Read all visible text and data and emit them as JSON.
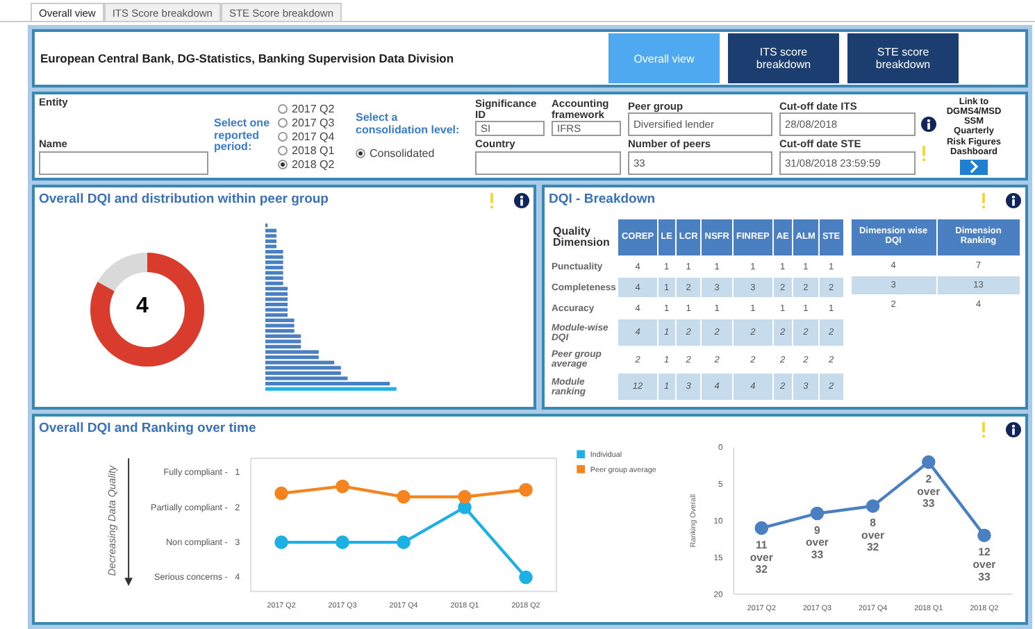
{
  "tabs": [
    {
      "label": "Overall view",
      "selected": true
    },
    {
      "label": "ITS Score breakdown",
      "selected": false
    },
    {
      "label": "STE Score breakdown",
      "selected": false
    }
  ],
  "header": {
    "title": "European Central Bank, DG-Statistics, Banking Supervision Data Division",
    "nav": [
      {
        "label": "Overall view",
        "selected": true
      },
      {
        "label": "ITS score breakdown",
        "selected": false
      },
      {
        "label": "STE score breakdown",
        "selected": false
      }
    ]
  },
  "filters": {
    "entity": {
      "label": "Entity"
    },
    "name": {
      "label": "Name"
    },
    "period": {
      "label": "Select one reported period:",
      "options": [
        {
          "label": "2017 Q2",
          "selected": false
        },
        {
          "label": "2017 Q3",
          "selected": false
        },
        {
          "label": "2017 Q4",
          "selected": false
        },
        {
          "label": "2018 Q1",
          "selected": false
        },
        {
          "label": "2018 Q2",
          "selected": true
        }
      ]
    },
    "consolidation": {
      "label": "Select a consolidation level:",
      "options": [
        {
          "label": "Consolidated",
          "selected": true
        }
      ]
    },
    "significance_id": {
      "label": "Significance ID",
      "value": "SI"
    },
    "accounting_framework": {
      "label": "Accounting framework",
      "value": "IFRS"
    },
    "country": {
      "label": "Country"
    },
    "peer_group": {
      "label": "Peer group",
      "value": "Diversified lender"
    },
    "number_of_peers": {
      "label": "Number of peers",
      "value": "33"
    },
    "cutoff_its": {
      "label": "Cut-off date ITS",
      "value": "28/08/2018"
    },
    "cutoff_ste": {
      "label": "Cut-off date STE",
      "value": "31/08/2018 23:59:59"
    },
    "link": {
      "label": "Link to DGMS4/MSD SSM Quarterly Risk Figures Dashboard"
    }
  },
  "overview": {
    "title": "Overall DQI and distribution within peer group",
    "score": "4",
    "level": 0.83
  },
  "breakdown": {
    "title": "DQI - Breakdown",
    "corner": "Quality Dimension",
    "modules": [
      "COREP",
      "LE",
      "LCR",
      "NSFR",
      "FINREP",
      "AE",
      "ALM",
      "STE"
    ],
    "rows": [
      {
        "label": "Punctuality",
        "kind": "dimension",
        "values": [
          "4",
          "1",
          "1",
          "1",
          "1",
          "1",
          "1",
          "1"
        ]
      },
      {
        "label": "Completeness",
        "kind": "dimension",
        "values": [
          "4",
          "1",
          "2",
          "3",
          "3",
          "2",
          "2",
          "2"
        ]
      },
      {
        "label": "Accuracy",
        "kind": "dimension",
        "values": [
          "4",
          "1",
          "1",
          "1",
          "1",
          "1",
          "1",
          "1"
        ]
      },
      {
        "label": "Module-wise DQI",
        "kind": "summary",
        "values": [
          "4",
          "1",
          "2",
          "2",
          "2",
          "2",
          "2",
          "2"
        ]
      },
      {
        "label": "Peer group average",
        "kind": "summary",
        "values": [
          "2",
          "1",
          "2",
          "2",
          "2",
          "2",
          "2",
          "2"
        ]
      },
      {
        "label": "Module ranking",
        "kind": "summary",
        "values": [
          "12",
          "1",
          "3",
          "4",
          "4",
          "2",
          "3",
          "2"
        ]
      }
    ],
    "side_columns": [
      "Dimension wise DQI",
      "Dimension Ranking"
    ],
    "side_rows": [
      [
        "4",
        "7"
      ],
      [
        "3",
        "13"
      ],
      [
        "2",
        "4"
      ]
    ]
  },
  "over_time": {
    "title": "Overall DQI and Ranking over time",
    "quality_chart": {
      "tick_descriptions": [
        "Fully compliant -",
        "Partially compliant -",
        "Non compliant -",
        "Serious concerns -"
      ],
      "chart_data": {
        "type": "line",
        "ylabel": "Decreasing Data Quality",
        "categories": [
          "2017 Q2",
          "2017 Q3",
          "2017 Q4",
          "2018 Q1",
          "2018 Q2"
        ],
        "ylim": [
          4.4,
          0.6
        ],
        "yticks": [
          1,
          2,
          3,
          4
        ],
        "legend": "right",
        "series": [
          {
            "name": "Individual",
            "color": "#1cb0e4",
            "marker": "circle",
            "values": [
              3,
              3,
              3,
              2,
              4
            ]
          },
          {
            "name": "Peer group average",
            "color": "#f5841f",
            "marker": "circle",
            "values": [
              1.6,
              1.4,
              1.7,
              1.7,
              1.5
            ]
          }
        ]
      }
    },
    "ranking_chart": {
      "chart_data": {
        "type": "line",
        "ylabel": "Ranking Overall",
        "categories": [
          "2017 Q2",
          "2017 Q3",
          "2017 Q4",
          "2018 Q1",
          "2018 Q2"
        ],
        "ylim": [
          20,
          0
        ],
        "yticks": [
          0,
          5,
          10,
          15,
          20
        ],
        "series": [
          {
            "color": "#4a7fc1",
            "marker": "circle",
            "values": [
              11,
              9,
              8,
              2,
              12
            ]
          }
        ],
        "value_labels": [
          "11 over 32",
          "9 over 33",
          "8 over 32",
          "2 over 33",
          "12 over 33"
        ]
      }
    }
  }
}
